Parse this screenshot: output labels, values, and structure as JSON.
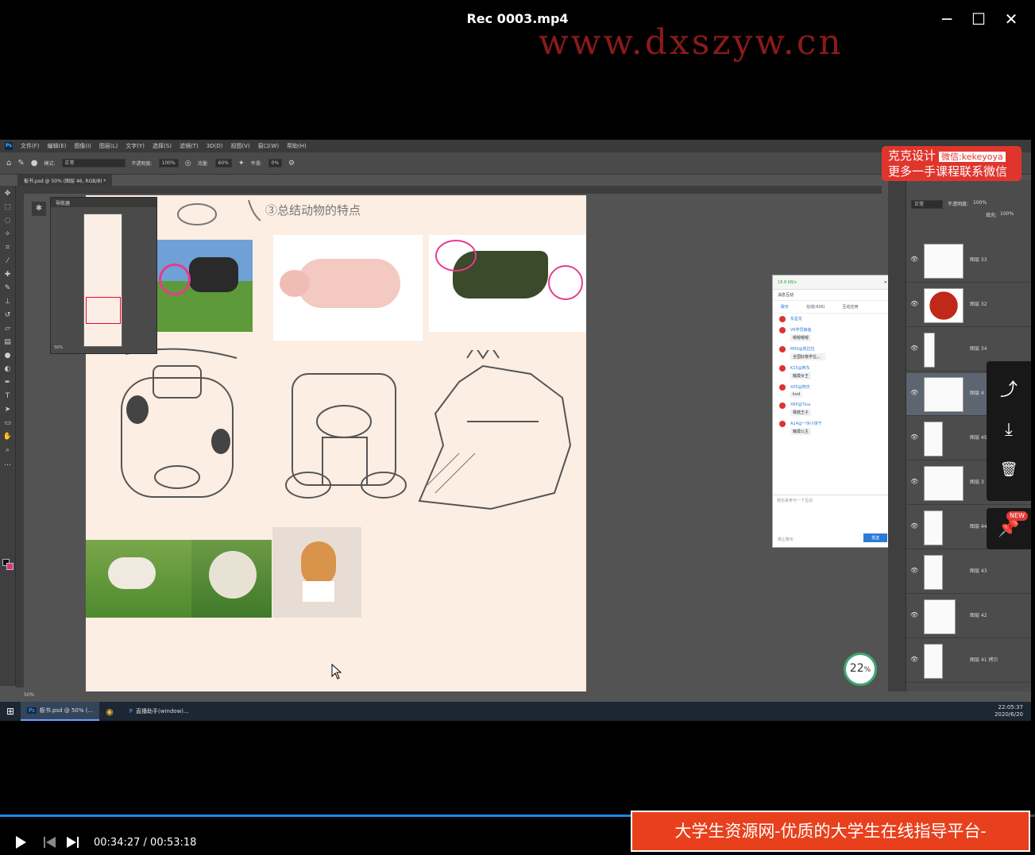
{
  "player": {
    "title": "Rec 0003.mp4",
    "watermark": "www.dxszyw.cn",
    "minimize": "─",
    "maximize": "☐",
    "close": "✕",
    "current_time": "00:34:27",
    "duration": "00:53:18",
    "time_sep": " / ",
    "progress": 0.646,
    "banner": "大学生资源网-优质的大学生在线指导平台-www.dxszyw.cn"
  },
  "photoshop": {
    "menu": [
      "文件(F)",
      "编辑(E)",
      "图像(I)",
      "图层(L)",
      "文字(Y)",
      "选择(S)",
      "滤镜(T)",
      "3D(D)",
      "视图(V)",
      "窗口(W)",
      "帮助(H)"
    ],
    "options": {
      "mode_label": "模式:",
      "mode_value": "正常",
      "opacity_label": "不透明度:",
      "opacity_value": "100%",
      "flow_label": "流量:",
      "flow_value": "60%",
      "smooth_label": "平滑:",
      "smooth_value": "0%"
    },
    "doc_tab": "板书.psd @ 50% (图层 46, RGB/8) *",
    "navigator": {
      "title": "导航器",
      "zoom": "50%"
    },
    "canvas_heading": "③总结动物的特点",
    "status": "50%"
  },
  "chat": {
    "window_title": "18.8 KB/s",
    "tabs": [
      "聊天",
      "在线(426)",
      "互动应用"
    ],
    "section": "消息互动",
    "messages": [
      {
        "name": "东星龙",
        "text": ""
      },
      {
        "name": "V6学员鲸鱼",
        "text": "嗯嗯嗯嗯"
      },
      {
        "name": "M50@凯拉拉",
        "text": "全国好像学位。。"
      },
      {
        "name": "K15@阿东",
        "text": "触摸女王"
      },
      {
        "name": "X05@阿杰",
        "text": "kvd"
      },
      {
        "name": "X6P@Tina",
        "text": "霉菇王子"
      },
      {
        "name": "A14@一块小饼干",
        "text": "触摸公主"
      }
    ],
    "input_placeholder": "我也来参与一下互动",
    "footer": "禁止聊天",
    "send": "发送"
  },
  "layers": {
    "blend_mode": "正常",
    "opacity_label": "不透明度:",
    "opacity": "100%",
    "fill_label": "填充:",
    "fill": "100%",
    "items": [
      {
        "name": "图层 33"
      },
      {
        "name": "图层 32"
      },
      {
        "name": "图层 34"
      },
      {
        "name": "图层 4"
      },
      {
        "name": "图层 45"
      },
      {
        "name": "图层 3"
      },
      {
        "name": "图层 44"
      },
      {
        "name": "图层 43"
      },
      {
        "name": "图层 42"
      },
      {
        "name": "图层 41 拷贝"
      }
    ]
  },
  "brand": {
    "line1": "克克设计",
    "wechat": "微信:kekeyoya",
    "line2": "更多一手课程联系微信"
  },
  "speed": {
    "value": "22",
    "unit": "%"
  },
  "taskbar": {
    "items": [
      "板书.psd @ 50% (...",
      "",
      "直播助手(window)..."
    ],
    "time": "22:05:37",
    "date": "2020/6/20"
  },
  "side_actions": {
    "share": "⤴",
    "download": "⤓",
    "delete": "🗑",
    "pin": "📌",
    "new_badge": "NEW"
  }
}
